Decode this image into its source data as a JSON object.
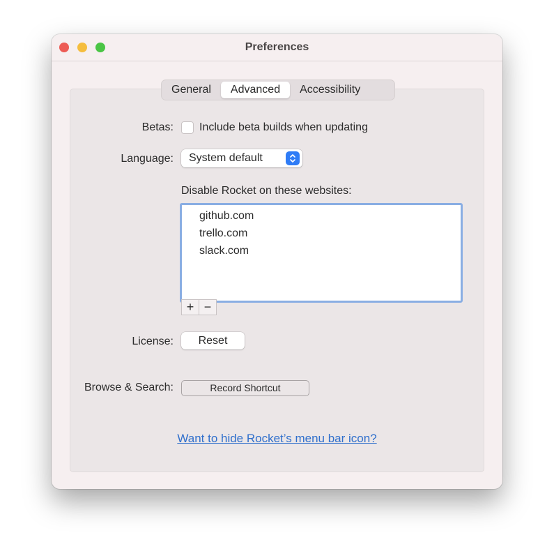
{
  "window": {
    "title": "Preferences",
    "traffic_lights": [
      "close",
      "minimize",
      "zoom"
    ]
  },
  "tabs": [
    {
      "label": "General",
      "active": false
    },
    {
      "label": "Advanced",
      "active": true
    },
    {
      "label": "Accessibility",
      "active": false
    }
  ],
  "betas": {
    "label": "Betas:",
    "checkbox_label": "Include beta builds when updating",
    "checked": false
  },
  "language": {
    "label": "Language:",
    "value": "System default",
    "icon": "up-down-chevron-icon"
  },
  "disabled_sites": {
    "label": "Disable Rocket on these websites:",
    "items": [
      "github.com",
      "trello.com",
      "slack.com"
    ],
    "add_label": "+",
    "remove_label": "−"
  },
  "license": {
    "label": "License:",
    "button": "Reset"
  },
  "shortcut": {
    "label": "Browse & Search:",
    "button": "Record Shortcut"
  },
  "link": {
    "text": "Want to hide Rocket’s menu bar icon?"
  },
  "colors": {
    "accent": "#2f7cf6",
    "link": "#2f6fcc",
    "focus_ring": "#8aaee3"
  }
}
